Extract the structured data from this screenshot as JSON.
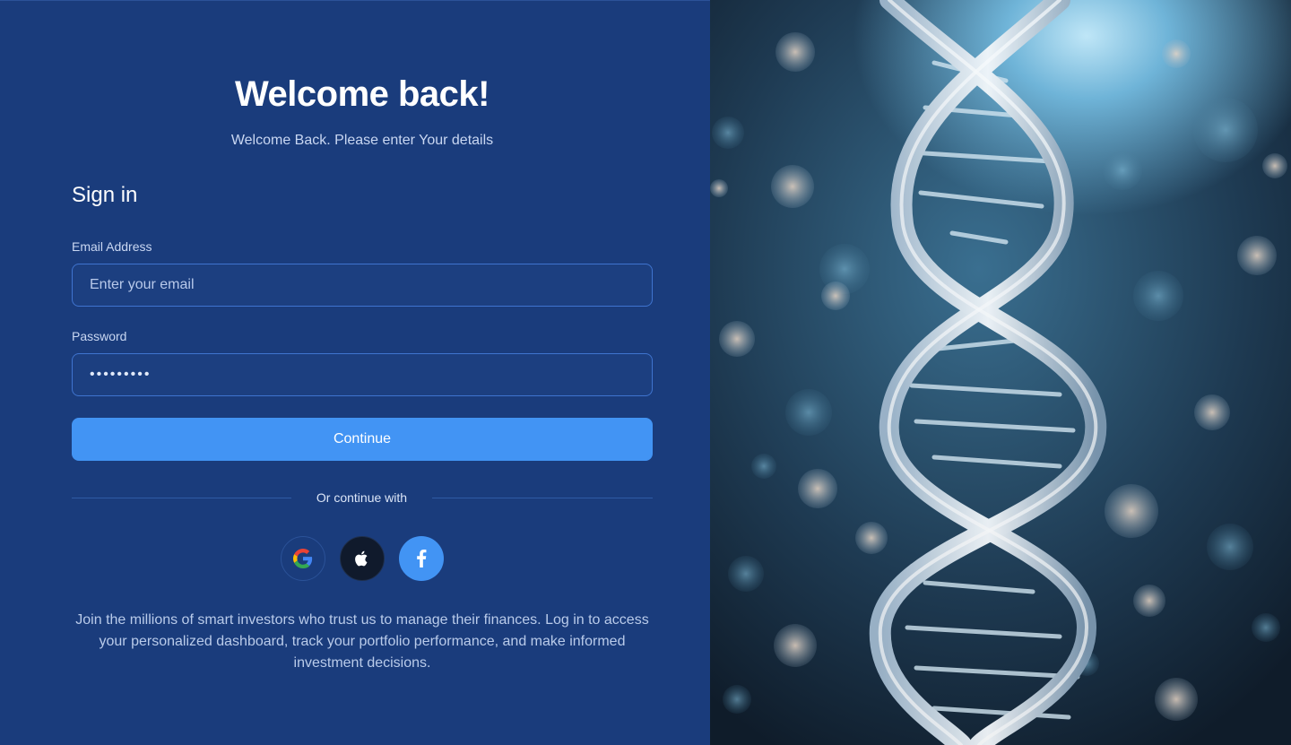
{
  "header": {
    "title": "Welcome back!",
    "subtitle": "Welcome Back. Please enter Your details"
  },
  "form": {
    "heading": "Sign in",
    "email": {
      "label": "Email Address",
      "placeholder": "Enter your email",
      "value": ""
    },
    "password": {
      "label": "Password",
      "value": "•••••••••"
    },
    "submit_label": "Continue"
  },
  "social": {
    "divider_text": "Or continue with",
    "providers": [
      {
        "name": "Google",
        "icon": "google-icon"
      },
      {
        "name": "Apple",
        "icon": "apple-icon"
      },
      {
        "name": "Facebook",
        "icon": "facebook-icon"
      }
    ]
  },
  "footer": {
    "text": "Join the millions of smart investors who trust us to manage their finances. Log in to access your personalized dashboard, track your portfolio performance, and make informed investment decisions."
  },
  "hero_image": {
    "icon": "dna-helix-image"
  },
  "colors": {
    "background": "#1a3c7c",
    "accent": "#4294f4",
    "input_border": "#3f74cf"
  }
}
